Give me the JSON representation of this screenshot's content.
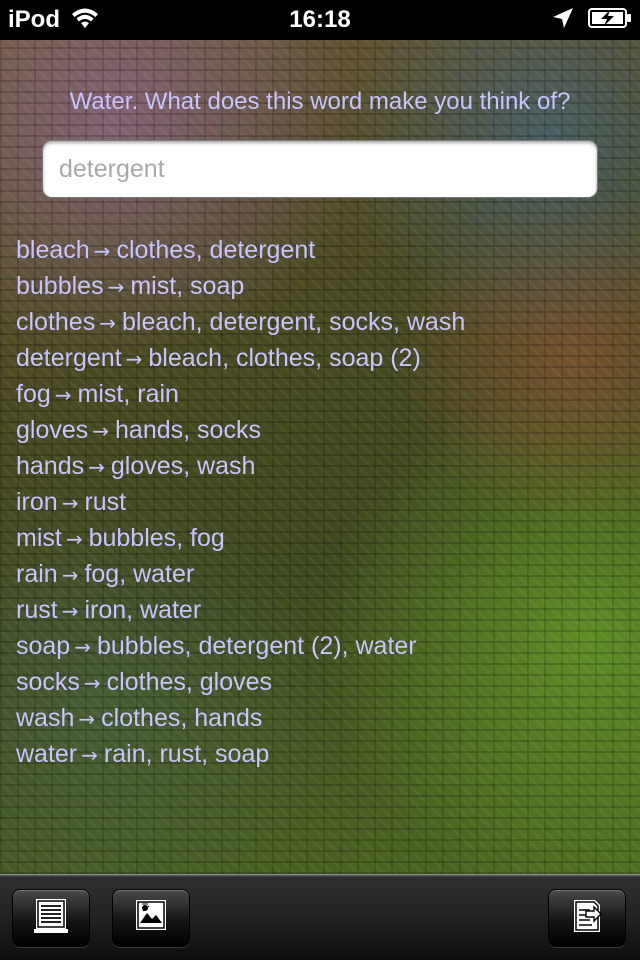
{
  "status_bar": {
    "carrier": "iPod",
    "time": "16:18",
    "icons": [
      "wifi-icon",
      "location-arrow-icon",
      "battery-charging-icon"
    ]
  },
  "prompt": "Water.  What does this word make you think of?",
  "search": {
    "value": "",
    "placeholder": "detergent"
  },
  "associations": [
    {
      "word": "bleach",
      "arrow": "→",
      "related": "clothes, detergent"
    },
    {
      "word": "bubbles",
      "arrow": "→",
      "related": "mist, soap"
    },
    {
      "word": "clothes",
      "arrow": "→",
      "related": "bleach, detergent, socks, wash"
    },
    {
      "word": "detergent",
      "arrow": "→",
      "related": "bleach, clothes, soap (2)"
    },
    {
      "word": "fog",
      "arrow": "→",
      "related": "mist, rain"
    },
    {
      "word": "gloves",
      "arrow": "→",
      "related": "hands, socks"
    },
    {
      "word": "hands",
      "arrow": "→",
      "related": "gloves, wash"
    },
    {
      "word": "iron",
      "arrow": "→",
      "related": "rust"
    },
    {
      "word": "mist",
      "arrow": "→",
      "related": "bubbles, fog"
    },
    {
      "word": "rain",
      "arrow": "→",
      "related": "fog, water"
    },
    {
      "word": "rust",
      "arrow": "→",
      "related": "iron, water"
    },
    {
      "word": "soap",
      "arrow": "→",
      "related": "bubbles, detergent (2), water"
    },
    {
      "word": "socks",
      "arrow": "→",
      "related": "clothes, gloves"
    },
    {
      "word": "wash",
      "arrow": "→",
      "related": "clothes, hands"
    },
    {
      "word": "water",
      "arrow": "→",
      "related": "rain, rust, soap"
    }
  ],
  "toolbar": {
    "buttons": [
      "list-document-icon",
      "picture-icon",
      "export-document-icon"
    ]
  },
  "colors": {
    "text_accent": "#c7c3ff",
    "status_bar": "#000000"
  }
}
